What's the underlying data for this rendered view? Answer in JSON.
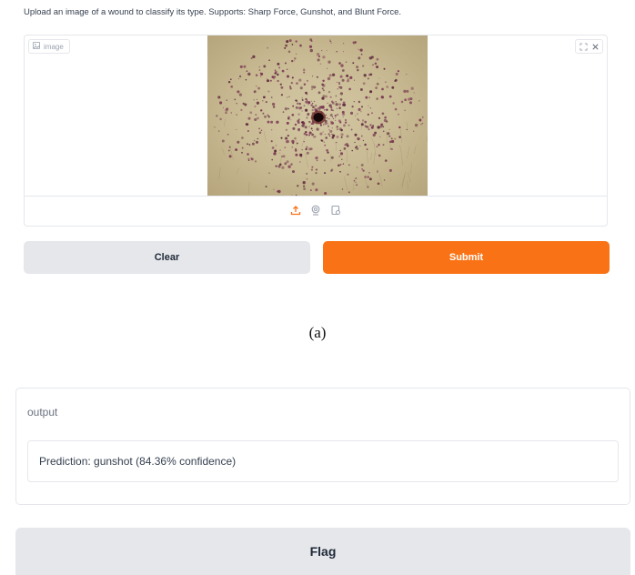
{
  "description": "Upload an image of a wound to classify its type. Supports: Sharp Force, Gunshot, and Blunt Force.",
  "image_input": {
    "label": "image",
    "icons": [
      "image-icon",
      "fullscreen-icon",
      "close-icon",
      "upload-icon",
      "webcam-icon",
      "clipboard-icon"
    ]
  },
  "buttons": {
    "clear": "Clear",
    "submit": "Submit",
    "flag": "Flag"
  },
  "captions": {
    "a": "(a)"
  },
  "output": {
    "label": "output",
    "text": "Prediction: gunshot (84.36% confidence)"
  },
  "colors": {
    "accent": "#f97316",
    "secondary": "#e5e7eb",
    "text": "#1f2937",
    "muted": "#9ca3af"
  }
}
